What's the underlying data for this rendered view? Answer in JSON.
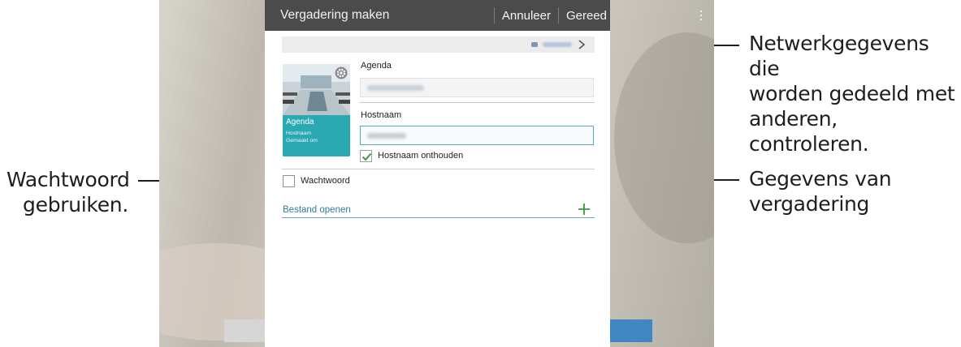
{
  "dialog": {
    "title": "Vergadering maken",
    "cancel_label": "Annuleer",
    "done_label": "Gereed"
  },
  "thumbnail": {
    "title": "Agenda",
    "line1": "Hostnaam",
    "line2": "Gemaakt om"
  },
  "form": {
    "agenda_label": "Agenda",
    "hostname_label": "Hostnaam",
    "remember_label": "Hostnaam onthouden",
    "remember_checked": true,
    "password_label": "Wachtwoord",
    "password_checked": false,
    "open_file_label": "Bestand openen"
  },
  "callouts": {
    "network_line1": "Netwerkgegevens die",
    "network_line2": "worden gedeeld met",
    "network_line3": "anderen, controleren.",
    "meeting_line1": "Gegevens van",
    "meeting_line2": "vergadering",
    "password_line1": "Wachtwoord",
    "password_line2": "gebruiken."
  },
  "colors": {
    "titlebar": "#4b4b4b",
    "accent": "#2aa9b2",
    "link": "#2e7d9e",
    "check": "#3d9b3d"
  },
  "icons": {
    "gear": "gear-icon",
    "chevron": "chevron-right-icon",
    "plus": "plus-icon",
    "more": "more-vert-icon"
  }
}
